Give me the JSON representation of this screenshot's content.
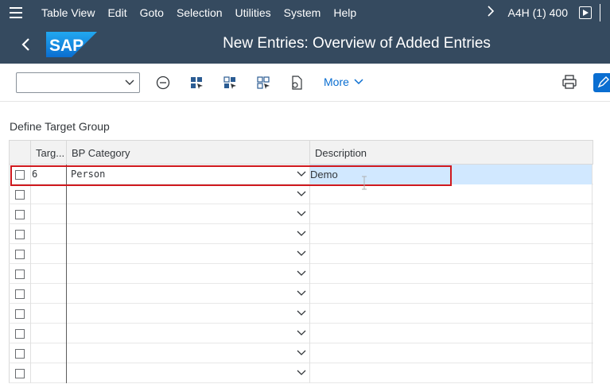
{
  "menubar": {
    "items": [
      "Table View",
      "Edit",
      "Goto",
      "Selection",
      "Utilities",
      "System",
      "Help"
    ],
    "system_info": "A4H (1) 400"
  },
  "titlebar": {
    "logo_text": "SAP",
    "title": "New Entries: Overview of Added Entries"
  },
  "toolbar": {
    "select_value": "",
    "more_label": "More"
  },
  "section": {
    "title": "Define Target Group"
  },
  "table": {
    "columns": [
      "Targ...",
      "BP Category",
      "Description"
    ],
    "rows": [
      {
        "target": "6",
        "category": "Person",
        "description": "Demo"
      },
      {
        "target": "",
        "category": "",
        "description": ""
      },
      {
        "target": "",
        "category": "",
        "description": ""
      },
      {
        "target": "",
        "category": "",
        "description": ""
      },
      {
        "target": "",
        "category": "",
        "description": ""
      },
      {
        "target": "",
        "category": "",
        "description": ""
      },
      {
        "target": "",
        "category": "",
        "description": ""
      },
      {
        "target": "",
        "category": "",
        "description": ""
      },
      {
        "target": "",
        "category": "",
        "description": ""
      },
      {
        "target": "",
        "category": "",
        "description": ""
      },
      {
        "target": "",
        "category": "",
        "description": ""
      }
    ]
  },
  "colors": {
    "shell": "#354a5f",
    "accent": "#0a6ed1",
    "highlight": "#d0191e",
    "active_cell": "#d1e8ff"
  }
}
